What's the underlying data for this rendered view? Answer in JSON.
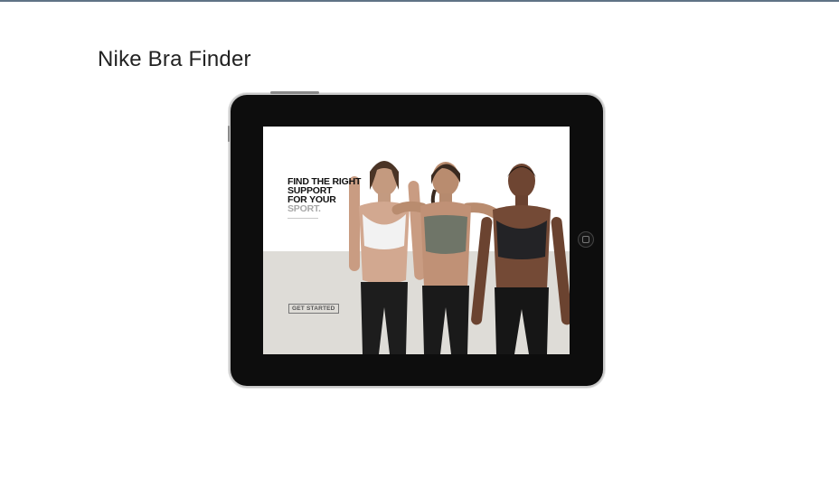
{
  "slide": {
    "title": "Nike Bra Finder"
  },
  "tablet_screen": {
    "headline": [
      "FIND THE RIGHT",
      "SUPPORT",
      "FOR YOUR"
    ],
    "headline_accent": "SPORT.",
    "cta_label": "GET STARTED",
    "image": "three athletes wearing sports bras",
    "colors": {
      "background": "#ffffff",
      "floor": "#dedcd7",
      "text": "#111111",
      "accent_text": "#a7a7a7"
    }
  },
  "icons": {
    "home_button": "home-button-icon"
  }
}
